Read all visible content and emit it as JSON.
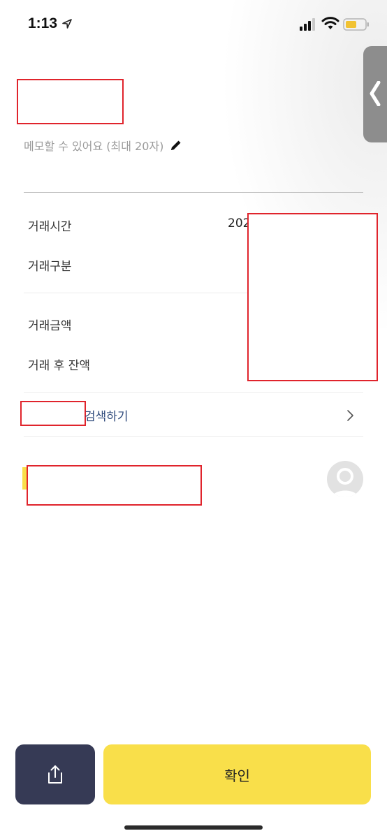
{
  "status_bar": {
    "time": "1:13",
    "icons": [
      "location-arrow-icon",
      "cellular-signal-icon",
      "wifi-icon",
      "battery-icon"
    ],
    "battery_color": "#f1c232"
  },
  "memo": {
    "placeholder": "메모할 수 있어요 (최대 20자)",
    "icon": "pencil-icon"
  },
  "details": {
    "time_label": "거래시간",
    "time_value_partial": "202",
    "type_label": "거래구분",
    "amount_label": "거래금액",
    "balance_label": "거래 후 잔액"
  },
  "search": {
    "label": "검색하기",
    "icon": "chevron-right-icon"
  },
  "footer": {
    "share_icon": "share-icon",
    "confirm_label": "확인"
  },
  "colors": {
    "accent_yellow": "#f9df4a",
    "dark_button": "#363a55",
    "link_blue": "#2f4b7c",
    "redaction": "#e0242c"
  }
}
